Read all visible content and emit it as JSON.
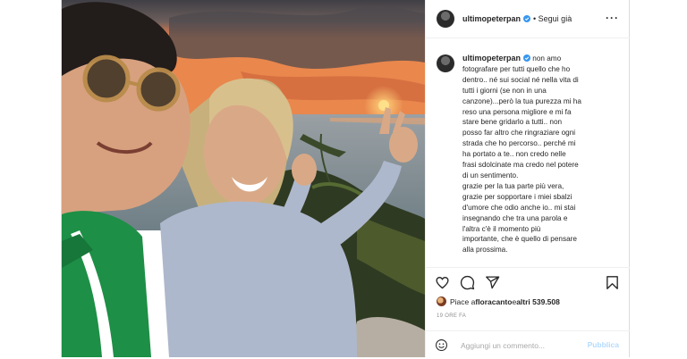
{
  "post": {
    "author": {
      "username": "ultimopeterpan",
      "verified": true,
      "follow_label": "• Segui già"
    },
    "more_icon": "more-horizontal-icon",
    "photo": {
      "description_icon": "couple-sunset-photo"
    },
    "caption": {
      "username": "ultimopeterpan",
      "text": "non amo\nfotografare per tutti quello che ho\ndentro.. né sui social né nella vita di\ntutti i giorni (se non in una\ncanzone)...però la tua purezza mi ha\nreso una persona migliore e mi fa\nstare bene gridarlo a tutti.. non\nposso far altro che ringraziare ogni\nstrada che ho percorso.. perché mi\nha portato a te.. non credo nelle\nfrasi sdolcinate ma credo nel potere\ndi un sentimento.\ngrazie per la tua parte più vera,\ngrazie per sopportare i miei sbalzi\nd'umore che odio anche io.. mi stai\ninsegnando che tra una parola e\nl'altra c'è il momento più\nimportante, che è quello di pensare\nalla prossima."
    },
    "actions": {
      "like_icon": "heart-icon",
      "comment_icon": "comment-icon",
      "share_icon": "share-icon",
      "save_icon": "bookmark-icon"
    },
    "likes": {
      "prefix": "Piace a ",
      "user": "floracanto",
      "middle": " e ",
      "others": "altri 539.508"
    },
    "time": "19 ORE FA",
    "comment_box": {
      "emoji_icon": "emoji-icon",
      "placeholder": "Aggiungi un commento...",
      "publish_label": "Pubblica"
    }
  },
  "colors": {
    "text": "#262626",
    "muted": "#8e8e8e",
    "border": "#dbdbdb",
    "verified": "#3897f0",
    "publish_disabled": "#b3dbff"
  }
}
